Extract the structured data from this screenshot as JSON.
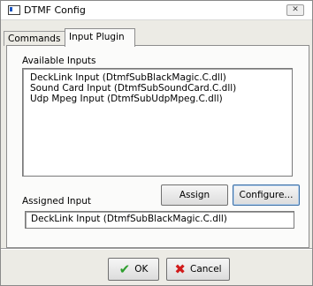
{
  "window": {
    "title": "DTMF Config",
    "close_icon": "close-icon",
    "app_icon": "window-icon"
  },
  "tabs": [
    {
      "label": "Commands",
      "selected": false
    },
    {
      "label": "Input Plugin",
      "selected": true
    }
  ],
  "available_inputs": {
    "label": "Available Inputs",
    "items": [
      "DeckLink Input (DtmfSubBlackMagic.C.dll)",
      "Sound Card Input (DtmfSubSoundCard.C.dll)",
      "Udp Mpeg Input (DtmfSubUdpMpeg.C.dll)"
    ]
  },
  "assigned_input": {
    "label": "Assigned Input",
    "value": "DeckLink Input (DtmfSubBlackMagic.C.dll)"
  },
  "buttons": {
    "assign": "Assign",
    "configure": "Configure...",
    "ok": "OK",
    "cancel": "Cancel"
  },
  "colors": {
    "ok_check": "#2e9e2e",
    "cancel_x": "#d11a1a"
  }
}
